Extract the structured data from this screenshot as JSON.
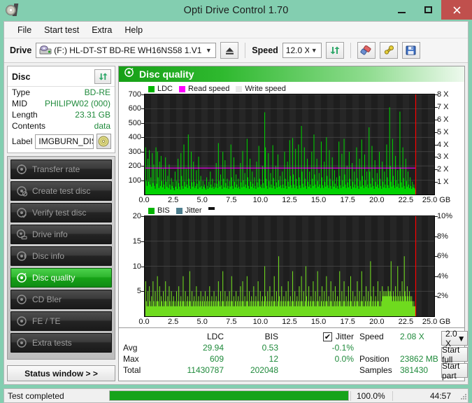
{
  "window": {
    "title": "Opti Drive Control 1.70",
    "icon": "disc-app-icon",
    "minimize": "minimize-icon",
    "maximize": "maximize-icon",
    "close": "close-icon"
  },
  "menubar": {
    "items": [
      {
        "label": "File"
      },
      {
        "label": "Start test"
      },
      {
        "label": "Extra"
      },
      {
        "label": "Help"
      }
    ]
  },
  "toolbar": {
    "drive_label": "Drive",
    "drive_value": "(F:)  HL-DT-ST BD-RE  WH16NS58 1.V1",
    "drive_icon": "drive-icon",
    "eject_icon": "eject-icon",
    "speed_label": "Speed",
    "speed_value": "12.0 X",
    "refresh_icon": "refresh-icon",
    "erase_icon": "eraser-icon",
    "settings_icon": "tools-icon",
    "save_icon": "save-icon"
  },
  "disc_panel": {
    "title": "Disc",
    "refresh_icon": "refresh-icon",
    "rows": [
      {
        "key": "Type",
        "value": "BD-RE"
      },
      {
        "key": "MID",
        "value": "PHILIPW02 (000)"
      },
      {
        "key": "Length",
        "value": "23.31 GB"
      },
      {
        "key": "Contents",
        "value": "data"
      }
    ],
    "label_key": "Label",
    "label_value": "IMGBURN_DIS",
    "label_button_icon": "disc-icon"
  },
  "nav": {
    "items": [
      {
        "label": "Transfer rate",
        "icon": "disc-gear-icon",
        "active": false
      },
      {
        "label": "Create test disc",
        "icon": "disc-write-icon",
        "active": false
      },
      {
        "label": "Verify test disc",
        "icon": "disc-check-icon",
        "active": false
      },
      {
        "label": "Drive info",
        "icon": "drive-info-icon",
        "active": false
      },
      {
        "label": "Disc info",
        "icon": "disc-info-icon",
        "active": false
      },
      {
        "label": "Disc quality",
        "icon": "disc-quality-icon",
        "active": true
      },
      {
        "label": "CD Bler",
        "icon": "disc-bler-icon",
        "active": false
      },
      {
        "label": "FE / TE",
        "icon": "disc-fete-icon",
        "active": false
      },
      {
        "label": "Extra tests",
        "icon": "disc-extra-icon",
        "active": false
      }
    ],
    "status_window_label": "Status window > >"
  },
  "main": {
    "header_title": "Disc quality",
    "header_icon": "disc-quality-icon"
  },
  "stats": {
    "col_headers": {
      "ldc": "LDC",
      "bis": "BIS",
      "jitter": "Jitter"
    },
    "rows": [
      {
        "label": "Avg",
        "ldc": "29.94",
        "bis": "0.53",
        "jitter": "-0.1%"
      },
      {
        "label": "Max",
        "ldc": "609",
        "bis": "12",
        "jitter": "0.0%"
      },
      {
        "label": "Total",
        "ldc": "11430787",
        "bis": "202048",
        "jitter": ""
      }
    ],
    "jitter_checked": true,
    "jitter_check_glyph": "✔",
    "speed_key": "Speed",
    "speed_value": "2.08 X",
    "position_key": "Position",
    "position_value": "23862 MB",
    "samples_key": "Samples",
    "samples_value": "381430",
    "speed_select_value": "2.0 X",
    "start_full_label": "Start full",
    "start_part_label": "Start part"
  },
  "statusbar": {
    "text": "Test completed",
    "percent_label": "100.0%",
    "percent_value": 100,
    "time": "44:57"
  },
  "colors": {
    "window_frame": "#83ceb0",
    "accent_green": "#16a016",
    "value_green": "#1f8a3b",
    "ldc_green": "#00d200",
    "bis_green": "#6fdb1e",
    "read_speed_magenta": "#ff00ff",
    "write_speed_white": "#e8e8e8",
    "jitter_blue": "#4d7f8f",
    "marker_red": "#ff0000",
    "plot_bg": "#232323",
    "close_button": "#c0504d",
    "progress_green": "#16a31a"
  },
  "chart_data": [
    {
      "type": "bar",
      "id": "ldc-chart",
      "title": "",
      "legend": [
        {
          "label": "LDC",
          "color": "#00b400"
        },
        {
          "label": "Read speed",
          "color": "#ff00ff"
        },
        {
          "label": "Write speed",
          "color": "#e8e8e8"
        }
      ],
      "legend_position": "top-left",
      "xlabel": "GB",
      "ylabel": "",
      "xlim": [
        0,
        25
      ],
      "ylim": [
        0,
        700
      ],
      "y2lim": [
        0,
        8
      ],
      "y2label": "X",
      "xticks": [
        "0.0",
        "2.5",
        "5.0",
        "7.5",
        "10.0",
        "12.5",
        "15.0",
        "17.5",
        "20.0",
        "22.5",
        "25.0 GB"
      ],
      "yticks": [
        100,
        200,
        300,
        400,
        500,
        600,
        700
      ],
      "y2ticks": [
        "1 X",
        "2 X",
        "3 X",
        "4 X",
        "5 X",
        "6 X",
        "7 X",
        "8 X"
      ],
      "grid": true,
      "data_end_x": 23.4,
      "marker_x": 23.4,
      "read_speed_line_y": 185,
      "series": [
        {
          "name": "LDC",
          "color": "#00d200",
          "x_start": 0.05,
          "x_end": 23.4,
          "values": [
            330,
            95,
            60,
            250,
            90,
            310,
            70,
            120,
            55,
            290,
            80,
            210,
            60,
            40,
            330,
            75,
            300,
            120,
            45,
            230,
            60,
            270,
            95,
            50,
            180,
            70,
            40,
            260,
            90,
            55,
            130,
            45,
            210,
            70,
            35,
            115,
            60,
            90,
            45,
            30,
            160,
            55,
            95,
            40,
            250,
            80,
            55,
            35,
            290,
            130,
            60,
            40,
            350,
            90,
            55,
            180,
            70,
            45,
            420,
            110,
            60,
            40,
            300,
            85,
            55,
            230,
            90,
            45,
            60,
            170,
            75,
            40,
            265,
            95,
            50,
            130,
            60,
            40,
            95,
            55,
            70,
            45,
            35,
            120,
            60,
            40,
            90,
            50,
            160,
            70,
            45,
            110,
            55,
            40,
            80,
            50,
            220,
            75,
            45,
            360,
            95,
            55,
            140,
            65,
            40,
            300,
            110,
            50,
            240,
            80,
            45,
            110,
            60,
            40,
            95,
            55,
            350,
            120,
            60,
            40,
            260,
            90,
            50,
            140,
            70,
            45,
            110,
            55,
            40,
            220,
            85,
            50,
            305,
            100,
            55,
            150,
            70,
            45,
            390,
            120,
            60,
            40,
            250,
            90,
            55,
            160,
            75,
            45,
            120,
            60,
            40,
            230,
            85,
            50,
            340,
            110,
            55,
            70,
            45,
            200,
            80,
            45,
            575,
            330,
            110,
            60,
            40,
            290,
            95,
            50,
            150,
            70,
            45,
            345,
            115,
            60,
            40,
            200,
            85,
            50,
            280,
            100,
            55,
            130,
            65,
            45,
            160,
            70,
            45,
            300,
            110,
            60,
            40,
            230,
            90,
            55,
            380,
            130,
            65,
            45,
            395,
            140,
            70,
            45,
            320,
            110,
            60,
            40,
            350,
            120,
            65,
            45,
            480,
            160,
            75,
            50,
            330,
            110,
            60,
            40,
            250,
            90,
            55,
            160,
            70,
            45,
            300,
            110,
            60,
            420,
            140,
            70,
            45,
            250,
            95,
            55,
            150,
            70,
            45,
            370,
            120,
            65,
            45,
            230,
            90,
            55,
            400,
            130,
            65,
            45,
            310,
            110,
            60,
            40,
            260,
            95,
            55,
            170,
            75,
            45,
            120,
            60,
            40,
            370,
            130,
            65,
            45,
            285,
            100,
            55,
            390,
            140,
            70,
            45,
            200,
            85,
            50,
            300,
            110,
            60,
            40,
            220,
            90,
            50,
            160,
            70,
            45,
            330,
            115,
            60,
            40,
            250,
            95,
            55,
            385,
            130,
            65,
            45,
            280,
            100,
            55,
            160,
            70,
            45,
            470,
            160,
            75,
            50,
            340,
            115,
            60,
            40,
            240,
            90,
            55,
            150,
            70,
            45,
            300,
            110,
            60,
            40,
            230,
            90,
            50,
            160,
            70,
            45,
            350,
            120,
            65,
            45,
            610,
            200,
            90,
            55,
            390,
            130,
            65,
            45,
            270,
            100,
            55,
            170,
            75,
            45,
            580,
            190,
            85,
            50,
            330,
            115,
            60,
            40,
            250,
            95,
            55,
            160,
            70,
            45,
            120,
            60,
            40,
            90,
            50,
            70,
            45,
            35
          ]
        }
      ]
    },
    {
      "type": "bar",
      "id": "bis-chart",
      "title": "",
      "legend": [
        {
          "label": "BIS",
          "color": "#00b400"
        },
        {
          "label": "Jitter",
          "color": "#4d7f8f"
        }
      ],
      "legend_position": "top-left",
      "xlabel": "GB",
      "ylabel": "",
      "xlim": [
        0,
        25
      ],
      "ylim": [
        0,
        20
      ],
      "y2lim": [
        0,
        10
      ],
      "y2label": "%",
      "xticks": [
        "0.0",
        "2.5",
        "5.0",
        "7.5",
        "10.0",
        "12.5",
        "15.0",
        "17.5",
        "20.0",
        "22.5",
        "25.0 GB"
      ],
      "yticks": [
        5,
        10,
        15,
        20
      ],
      "y2ticks": [
        "2%",
        "4%",
        "6%",
        "8%",
        "10%"
      ],
      "grid": true,
      "data_end_x": 23.4,
      "marker_x": 23.4,
      "series": [
        {
          "name": "BIS",
          "color": "#6fdb1e",
          "x_start": 0.05,
          "x_end": 23.4,
          "values": [
            7,
            3,
            2,
            5,
            2,
            6,
            3,
            2,
            4,
            2,
            7,
            3,
            2,
            5,
            2,
            3,
            8,
            3,
            2,
            6,
            2,
            4,
            3,
            2,
            5,
            2,
            3,
            7,
            3,
            2,
            4,
            2,
            6,
            3,
            2,
            5,
            2,
            3,
            4,
            2,
            3,
            2,
            5,
            2,
            3,
            6,
            2,
            3,
            4,
            2,
            3,
            8,
            3,
            2,
            5,
            2,
            3,
            4,
            2,
            3,
            9,
            3,
            2,
            5,
            2,
            3,
            4,
            2,
            3,
            6,
            2,
            3,
            4,
            2,
            3,
            5,
            2,
            3,
            4,
            2,
            3,
            5,
            2,
            3,
            4,
            2,
            3,
            6,
            2,
            3,
            4,
            2,
            3,
            5,
            2,
            3,
            4,
            2,
            3,
            7,
            3,
            2,
            5,
            2,
            3,
            9,
            3,
            2,
            5,
            2,
            3,
            4,
            2,
            3,
            5,
            2,
            3,
            8,
            3,
            2,
            4,
            2,
            3,
            5,
            2,
            3,
            4,
            2,
            3,
            6,
            2,
            3,
            7,
            3,
            2,
            4,
            2,
            3,
            8,
            3,
            2,
            5,
            2,
            3,
            4,
            2,
            3,
            6,
            2,
            3,
            4,
            2,
            3,
            7,
            3,
            2,
            5,
            2,
            3,
            4,
            2,
            3,
            10,
            4,
            2,
            3,
            5,
            2,
            3,
            6,
            2,
            3,
            4,
            2,
            3,
            8,
            3,
            2,
            5,
            2,
            3,
            12,
            4,
            2,
            3,
            6,
            2,
            3,
            4,
            2,
            3,
            5,
            2,
            3,
            7,
            3,
            2,
            4,
            2,
            3,
            9,
            3,
            2,
            5,
            2,
            3,
            4,
            2,
            3,
            6,
            2,
            3,
            8,
            3,
            2,
            5,
            2,
            3,
            10,
            4,
            2,
            3,
            6,
            2,
            3,
            4,
            2,
            3,
            7,
            3,
            2,
            5,
            2,
            3,
            9,
            3,
            2,
            4,
            2,
            3,
            6,
            2,
            3,
            5,
            2,
            3,
            8,
            3,
            2,
            4,
            2,
            3,
            7,
            3,
            2,
            5,
            2,
            3,
            6,
            2,
            3,
            4,
            2,
            3,
            9,
            3,
            2,
            5,
            2,
            3,
            7,
            3,
            2,
            4,
            2,
            3,
            6,
            2,
            3,
            8,
            3,
            2,
            5,
            2,
            3,
            4,
            2,
            3,
            7,
            3,
            2,
            5,
            2,
            3,
            9,
            3,
            2,
            4,
            2,
            3,
            6,
            2,
            3,
            5,
            2,
            3,
            11,
            4,
            2,
            3,
            6,
            2,
            3,
            4,
            2,
            3,
            7,
            3,
            2,
            5,
            2,
            3,
            6,
            4,
            5,
            4,
            5,
            4,
            5,
            4,
            6,
            5,
            4,
            5,
            11,
            4,
            3,
            5,
            4,
            3,
            6,
            4,
            3,
            10,
            4,
            3,
            5,
            4,
            3,
            7,
            4,
            3,
            12,
            5,
            4,
            3,
            6,
            4,
            3,
            5,
            4,
            3,
            4,
            3,
            2,
            3,
            2,
            2
          ]
        }
      ]
    }
  ]
}
